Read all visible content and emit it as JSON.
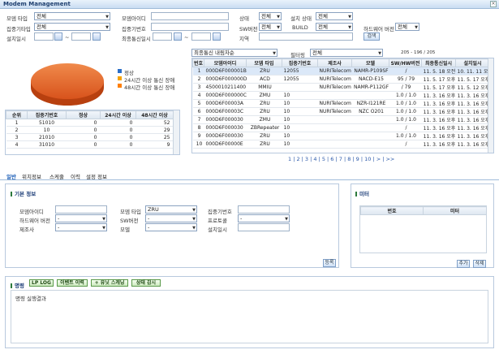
{
  "title": "Modem Management",
  "close": "×",
  "filters": {
    "modem_type_label": "모뎀 타입",
    "modem_type_value": "전체",
    "modem_id_label": "모뎀아이디",
    "status_label": "상태",
    "status_value": "전체",
    "install_status_label": "설치 상태",
    "install_status_value": "전체",
    "dcu_type_label": "집중기타입",
    "dcu_type_value": "전체",
    "dcu_no_label": "집중기번호",
    "sw_ver_label": "SW버전",
    "sw_ver_value": "전체",
    "build_label": "BUILD",
    "build_value": "전체",
    "hw_ver_label": "하드웨어 버전",
    "hw_ver_value": "전체",
    "install_date_label": "설치일시",
    "tilde1": "~",
    "last_comm_label": "최종통신일시",
    "tilde2": "~",
    "region_label": "지역",
    "search_btn": "검색"
  },
  "legend": {
    "normal": "정상",
    "h24": "24시간 이상 통신 장애",
    "h48": "48시간 이상 통신 장애"
  },
  "colors": {
    "normal": "#e8702a",
    "h24": "#f5a300",
    "h48": "#ff7f00"
  },
  "summary": {
    "headers": [
      "순위",
      "집중기번호",
      "정상",
      "24시간 이상",
      "48시간 이상"
    ],
    "rows": [
      [
        "1",
        "51010",
        "0",
        "0",
        "52"
      ],
      [
        "2",
        "10",
        "0",
        "0",
        "29"
      ],
      [
        "3",
        "21010",
        "0",
        "0",
        "25"
      ],
      [
        "4",
        "31010",
        "0",
        "0",
        "9"
      ]
    ]
  },
  "list": {
    "sort_value": "최종통신 내림차순",
    "filter_label": "필터링",
    "filter_value": "전체",
    "count": "205 - 196 / 205",
    "headers": [
      "번호",
      "모뎀아이디",
      "모뎀 타입",
      "집중기번호",
      "제조사",
      "모델",
      "SW/HW버전",
      "최종통신일시",
      "설치일시"
    ],
    "rows": [
      [
        "1",
        "000D6F000001B",
        "ZRU",
        "12055",
        "NURITelecom",
        "NAMR-P109SF",
        "/",
        "11. 5. 18 오전",
        "10. 11. 11 오후"
      ],
      [
        "2",
        "000D6F000000D",
        "ACD",
        "12055",
        "NURITelecom",
        "NACD-E15",
        "95 / 79",
        "11. 5. 17 오후",
        "11. 5. 17 오후"
      ],
      [
        "3",
        "4500010211400",
        "MMIU",
        "",
        "NURITelecom",
        "NAMR-P112GF",
        "/ 79",
        "11. 5. 17 오후",
        "11. 5. 12 오후"
      ],
      [
        "4",
        "000D6F000000C",
        "ZMU",
        "10",
        "",
        "",
        "1.0 / 1.0",
        "11. 3. 16 오후",
        "11. 3. 16 오후"
      ],
      [
        "5",
        "000D6F00003A",
        "ZRU",
        "10",
        "NURITelecom",
        "NZR-I121RE",
        "1.0 / 1.0",
        "11. 3. 16 오후",
        "11. 3. 16 오후"
      ],
      [
        "6",
        "000D6F00003C",
        "ZRU",
        "10",
        "NURITelecom",
        "NZC O201",
        "1.0 / 1.0",
        "11. 3. 16 오후",
        "11. 3. 16 오후"
      ],
      [
        "7",
        "000D6F000030",
        "ZMU",
        "10",
        "",
        "",
        "1.0 / 1.0",
        "11. 3. 16 오후",
        "11. 3. 16 오후"
      ],
      [
        "8",
        "000D6F000030",
        "ZBRepeater",
        "10",
        "",
        "",
        "/",
        "11. 3. 16 오후",
        "11. 3. 16 오후"
      ],
      [
        "9",
        "000D6F000030",
        "ZRU",
        "10",
        "",
        "",
        "1.0 / 1.0",
        "11. 3. 16 오후",
        "11. 3. 16 오후"
      ],
      [
        "10",
        "000D6F00000E",
        "ZRU",
        "10",
        "",
        "",
        "/",
        "11. 3. 16 오후",
        "11. 3. 16 오후"
      ]
    ],
    "pager": "1 | 2 | 3 | 4 | 5 | 6 | 7 | 8 | 9 | 10 | > | >>"
  },
  "tabs": [
    "일반",
    "위치정보",
    "스케줄",
    "이력",
    "설정 정보"
  ],
  "basic": {
    "title": "기본 정보",
    "modem_id": "모뎀아이디",
    "modem_type": "모뎀 타입",
    "modem_type_value": "ZRU",
    "dcu_no": "집중기번호",
    "hw_ver": "하드웨어 버전",
    "hw_ver_value": "-",
    "sw_ver": "SW버전",
    "sw_ver_value": "-",
    "protocol": "프로토콜",
    "protocol_value": "-",
    "maker": "제조사",
    "maker_value": "-",
    "model": "모델",
    "model_value": "-",
    "install_date": "설치일시",
    "register_btn": "등록"
  },
  "meter": {
    "title": "미터",
    "headers": [
      "번호",
      "미터"
    ],
    "add_btn": "추가",
    "del_btn": "삭제"
  },
  "command": {
    "title": "명령",
    "buttons": [
      "LP LOG",
      "이벤트 이력",
      "+ 유닛 스캐닝",
      "상태 감시"
    ],
    "result": "명령 실행결과"
  }
}
